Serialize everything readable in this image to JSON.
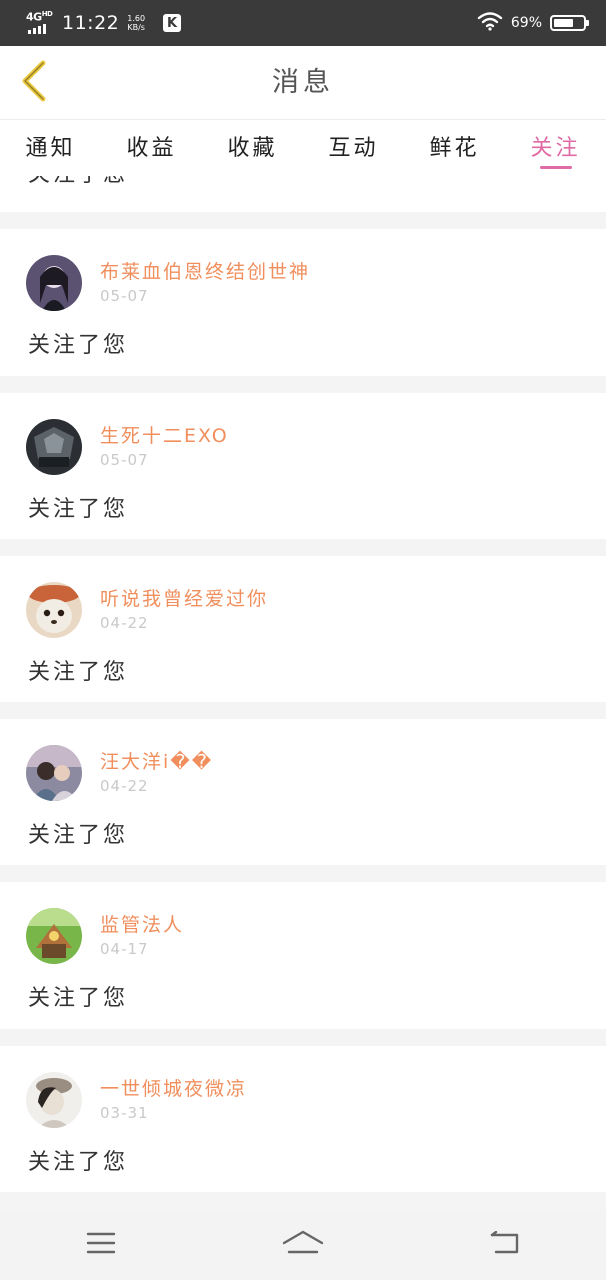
{
  "status_bar": {
    "network": "4G",
    "network_sup": "HD",
    "time": "11:22",
    "speed_value": "1.60",
    "speed_unit": "KB/s",
    "app_badge": "K",
    "battery_percent": "69%",
    "battery_level": 0.69
  },
  "header": {
    "title": "消息"
  },
  "tabs": [
    {
      "label": "通知",
      "active": false
    },
    {
      "label": "收益",
      "active": false
    },
    {
      "label": "收藏",
      "active": false
    },
    {
      "label": "互动",
      "active": false
    },
    {
      "label": "鲜花",
      "active": false
    },
    {
      "label": "关注",
      "active": true
    }
  ],
  "partial_item": {
    "message": "关注了您"
  },
  "items": [
    {
      "name": "布莱血伯恩终结创世神",
      "date": "05-07",
      "message": "关注了您"
    },
    {
      "name": "生死十二EXO",
      "date": "05-07",
      "message": "关注了您"
    },
    {
      "name": "听说我曾经爱过你",
      "date": "04-22",
      "message": "关注了您"
    },
    {
      "name": "汪大洋i��",
      "date": "04-22",
      "message": "关注了您"
    },
    {
      "name": "监管法人",
      "date": "04-17",
      "message": "关注了您"
    },
    {
      "name": "一世倾城夜微凉",
      "date": "03-31",
      "message": "关注了您"
    }
  ],
  "colors": {
    "accent": "#e06aa4",
    "username": "#f08f5d",
    "back_arrow": "#e8c93f"
  },
  "icons": {
    "back": "chevron-left-icon",
    "menu": "menu-icon",
    "home": "home-icon",
    "return": "return-icon"
  }
}
